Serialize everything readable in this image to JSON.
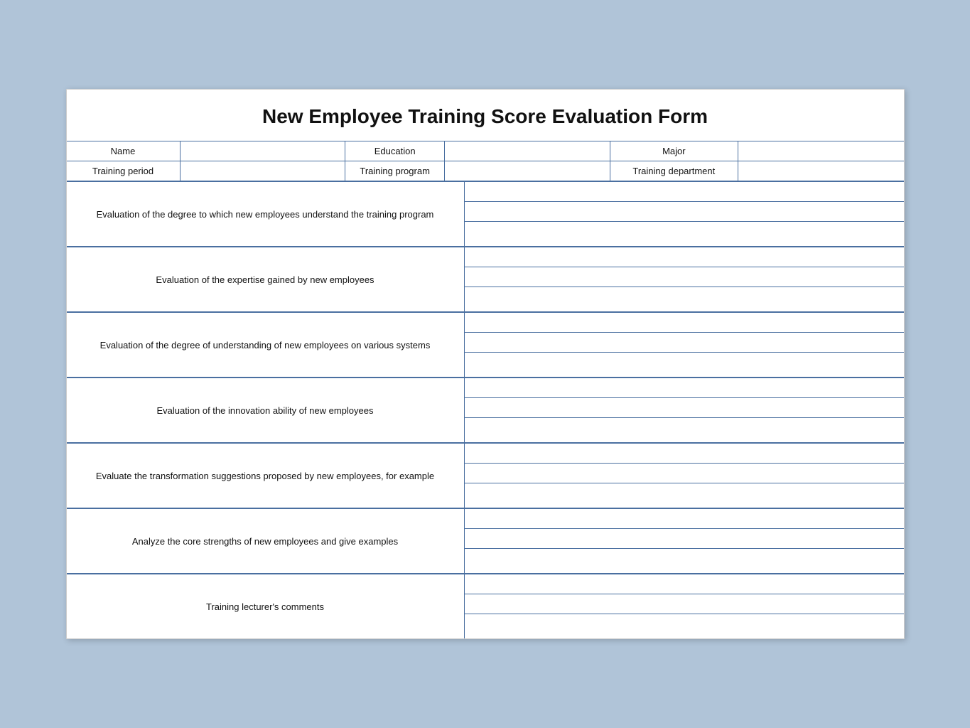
{
  "title": "New Employee Training Score Evaluation Form",
  "header": {
    "row1": {
      "name_label": "Name",
      "education_label": "Education",
      "major_label": "Major"
    },
    "row2": {
      "training_period_label": "Training period",
      "training_program_label": "Training program",
      "training_department_label": "Training department"
    }
  },
  "sections": [
    {
      "label": "Evaluation of the degree to which new employees understand the training program",
      "lines": 3
    },
    {
      "label": "Evaluation of the expertise gained by new employees",
      "lines": 3
    },
    {
      "label": "Evaluation of the degree of understanding of new employees on various systems",
      "lines": 3
    },
    {
      "label": "Evaluation of the innovation ability of new employees",
      "lines": 3
    },
    {
      "label": "Evaluate the transformation suggestions proposed by new employees, for example",
      "lines": 3
    },
    {
      "label": "Analyze the core strengths of new employees and give examples",
      "lines": 3
    },
    {
      "label": "Training lecturer's comments",
      "lines": 3
    }
  ]
}
